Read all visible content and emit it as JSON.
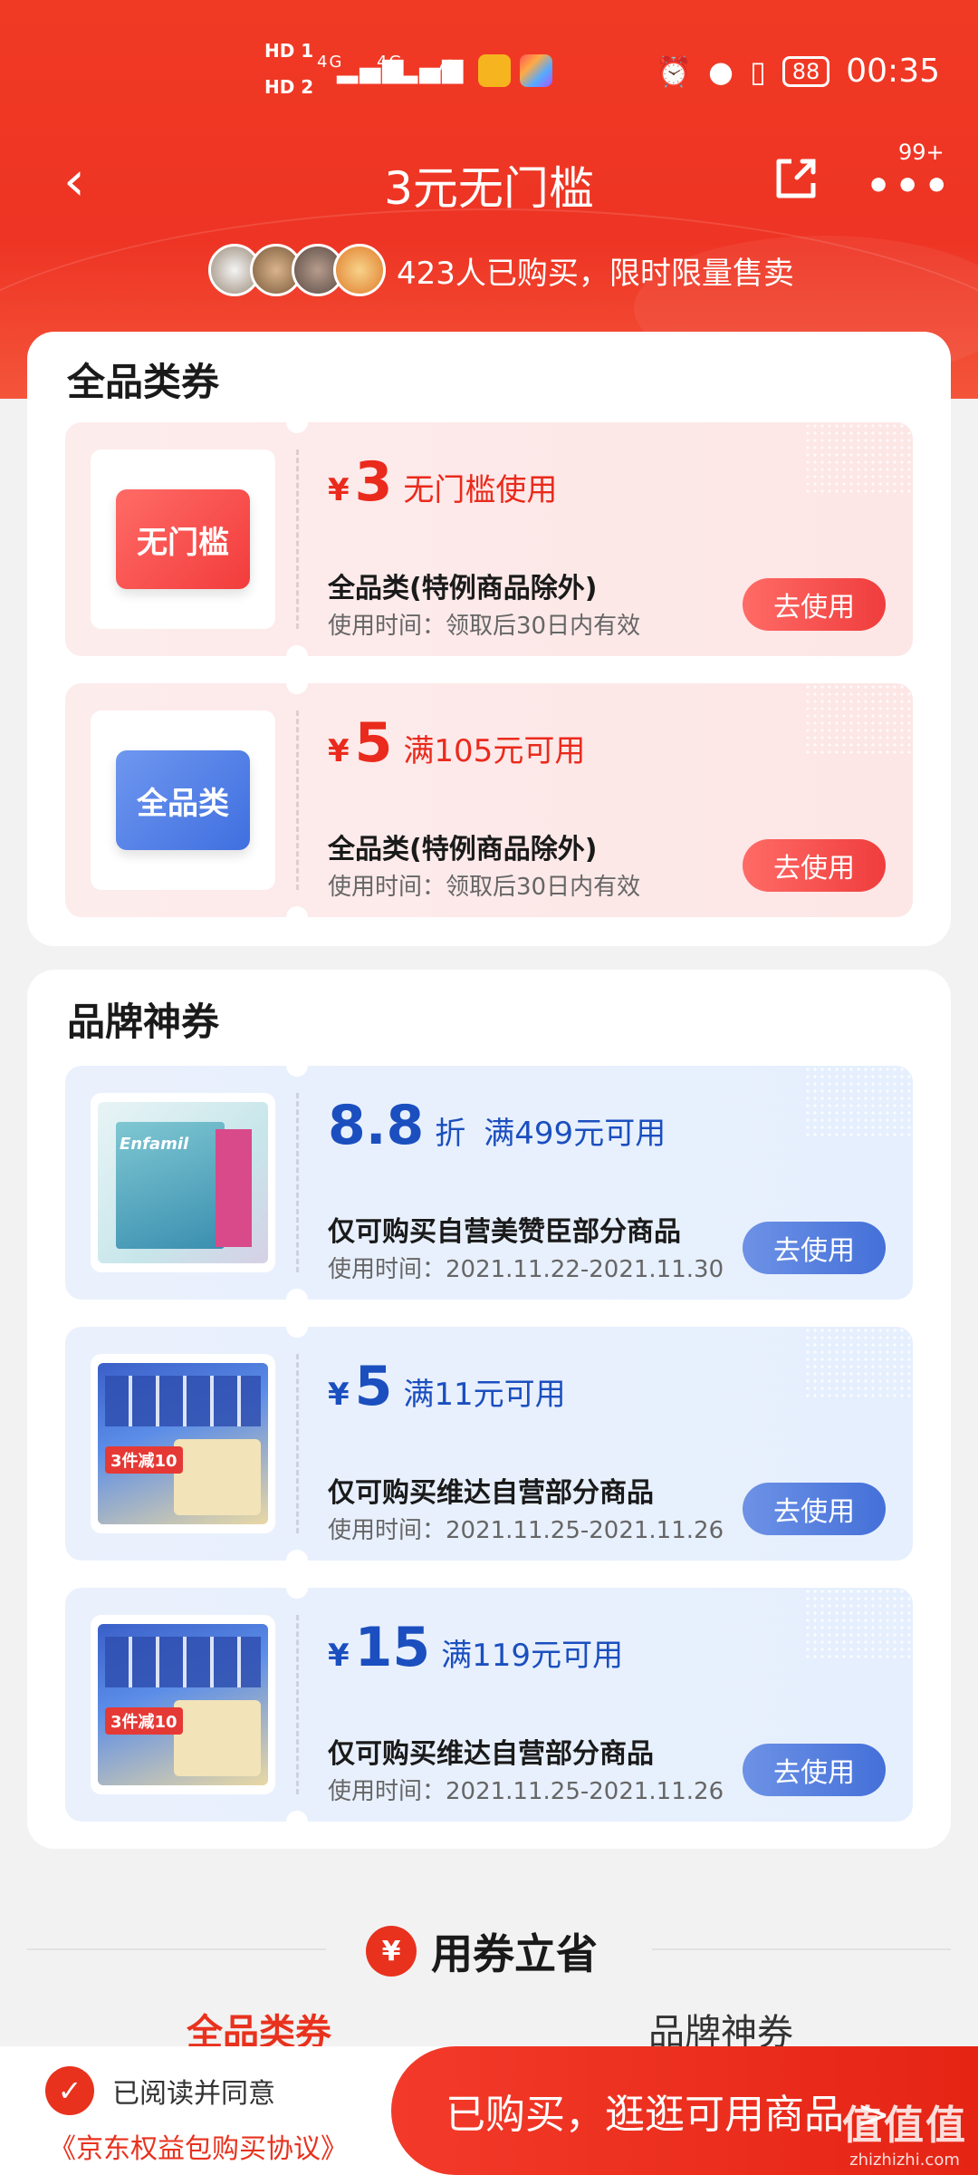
{
  "status_bar": {
    "hd1": "HD 1",
    "hd2": "HD 2",
    "network1": "4G",
    "network2": "4G",
    "battery": "88",
    "time": "00:35"
  },
  "nav": {
    "title": "3元无门槛",
    "more_badge": "99+"
  },
  "buyers": {
    "text": "423人已购买，限时限量售卖"
  },
  "sections": {
    "all_category": {
      "title": "全品类券",
      "coupons": [
        {
          "thumb_label": "无门槛",
          "currency": "¥",
          "amount": "3",
          "condition": "无门槛使用",
          "scope": "全品类(特例商品除外)",
          "time": "使用时间：领取后30日内有效",
          "button": "去使用"
        },
        {
          "thumb_label": "全品类",
          "currency": "¥",
          "amount": "5",
          "condition": "满105元可用",
          "scope": "全品类(特例商品除外)",
          "time": "使用时间：领取后30日内有效",
          "button": "去使用"
        }
      ]
    },
    "brand": {
      "title": "品牌神券",
      "coupons": [
        {
          "amount": "8.8",
          "unit": "折",
          "condition": "满499元可用",
          "scope": "仅可购买自营美赞臣部分商品",
          "time": "使用时间：2021.11.22-2021.11.30",
          "button": "去使用",
          "product_label": "Enfamil"
        },
        {
          "currency": "¥",
          "amount": "5",
          "condition": "满11元可用",
          "scope": "仅可购买维达自营部分商品",
          "time": "使用时间：2021.11.25-2021.11.26",
          "button": "去使用",
          "product_tag": "3件减10"
        },
        {
          "currency": "¥",
          "amount": "15",
          "condition": "满119元可用",
          "scope": "仅可购买维达自营部分商品",
          "time": "使用时间：2021.11.25-2021.11.26",
          "button": "去使用",
          "product_tag": "3件减10"
        }
      ]
    }
  },
  "save_section": {
    "icon": "¥",
    "title": "用券立省",
    "tabs": [
      "全品类券",
      "品牌神券"
    ]
  },
  "bottom_bar": {
    "agree_text": "已阅读并同意",
    "agreement_link": "《京东权益包购买协议》",
    "cta": "已购买，逛逛可用商品 >",
    "watermark": "值值值",
    "watermark_url": "zhizhizhi.com"
  },
  "colors": {
    "brand_red": "#e8321e",
    "coupon_blue": "#1b4fbf"
  }
}
